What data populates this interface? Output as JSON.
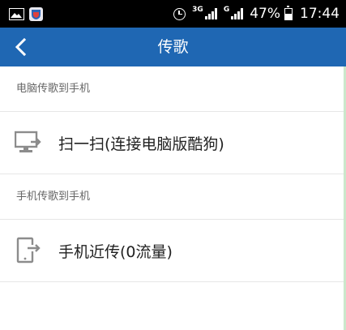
{
  "status_bar": {
    "network_1": "3G",
    "network_2": "G",
    "battery_percent": "47%",
    "battery_level": 0.47,
    "time": "17:44",
    "icons": [
      "image-icon",
      "app-icon",
      "alarm-icon",
      "signal-icon",
      "signal-icon",
      "battery-icon"
    ]
  },
  "header": {
    "title": "传歌",
    "back_icon": "back-arrow-icon",
    "background_color": "#1f67b3"
  },
  "sections": [
    {
      "header": "电脑传歌到手机",
      "item": {
        "label": "扫一扫(连接电脑版酷狗)",
        "icon": "monitor-transfer-icon"
      }
    },
    {
      "header": "手机传歌到手机",
      "item": {
        "label": "手机近传(0流量)",
        "icon": "phone-transfer-icon"
      }
    }
  ]
}
